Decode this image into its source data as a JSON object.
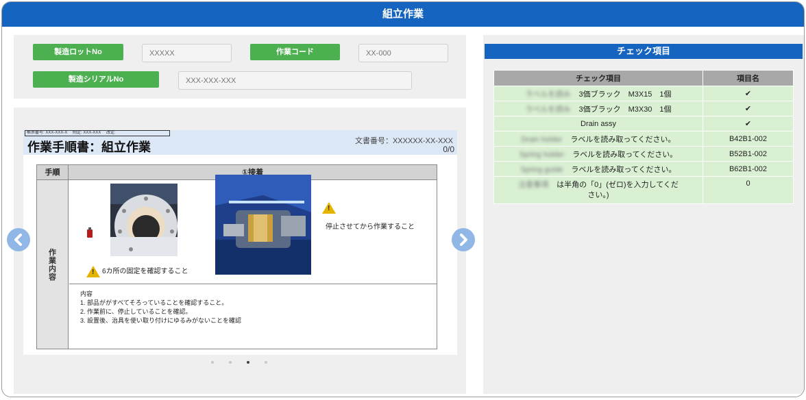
{
  "window": {
    "title": "組立作業"
  },
  "form": {
    "lot_label": "製造ロットNo",
    "lot_placeholder": "XXXXX",
    "work_code_label": "作業コード",
    "work_code_placeholder": "XX-000",
    "serial_label": "製造シリアルNo",
    "serial_placeholder": "XXX-XXX-XXX"
  },
  "document": {
    "header_small": "帳票番号: XXX-XXX-X　 制定: XXX-XXX　 改定:",
    "title": "作業手順書：組立作業",
    "doc_number": "文書番号：XXXXXX-XX-XXX",
    "page": "0/0",
    "col_procedure": "手順",
    "step_title": "①接着",
    "side_label": "作業内容",
    "warning_fix": "6カ所の固定を確認すること",
    "warning_stop": "停止させてから作業すること",
    "instructions": [
      "内容",
      "1. 部品ががすべてそろっていることを確認すること。",
      "2. 作業前に、停止していることを確認。",
      "3. 設置後、治具を使い取り付けにゆるみがないことを確認"
    ]
  },
  "carousel": {
    "pages": 4,
    "active_index": 2,
    "prev_icon": "chevron-left-icon",
    "next_icon": "chevron-right-icon"
  },
  "check_panel": {
    "title": "チェック項目",
    "columns": [
      "チェック項目",
      "項目名"
    ],
    "rows": [
      {
        "blurred": "ラベルを読み",
        "text": "3価ブラック　M3X15　1個",
        "value": "✔"
      },
      {
        "blurred": "ラベルを読み",
        "text": "3価ブラック　M3X30　1個",
        "value": "✔"
      },
      {
        "blurred": "",
        "text": "Drain assy",
        "value": "✔"
      },
      {
        "blurred": "Drain holder",
        "text": "ラベルを読み取ってください。",
        "value": "B42B1-002"
      },
      {
        "blurred": "Spring holder",
        "text": "ラベルを読み取ってください。",
        "value": "B52B1-002"
      },
      {
        "blurred": "Spring guide",
        "text": "ラベルを読み取ってください。",
        "value": "B62B1-002"
      },
      {
        "blurred": "注意事項",
        "text": "は半角の「0」(ゼロ)を入力してください。)",
        "value": "0"
      },
      {
        "blurred": "",
        "text": "",
        "value": ""
      }
    ]
  },
  "colors": {
    "accent": "#1565c0",
    "button_green": "#4caf50",
    "row_green": "#d9f0d3"
  }
}
